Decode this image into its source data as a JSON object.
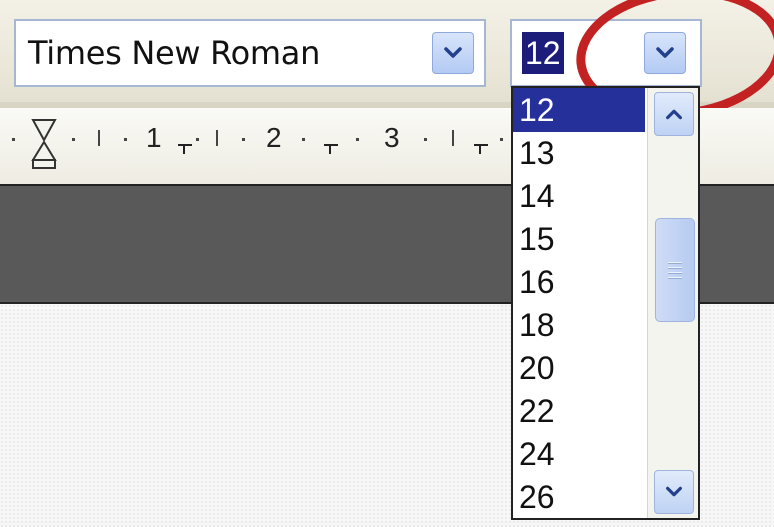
{
  "toolbar": {
    "font_name": "Times New Roman",
    "font_size": "12",
    "font_dropdown_icon": "chevron-down-icon",
    "size_dropdown_icon": "chevron-down-icon"
  },
  "ruler": {
    "numbers": [
      "1",
      "2",
      "3"
    ],
    "indent_marker_icon": "hourglass-indent-icon"
  },
  "size_list": {
    "options": [
      "12",
      "13",
      "14",
      "15",
      "16",
      "18",
      "20",
      "22",
      "24",
      "26"
    ],
    "selected": "12"
  },
  "colors": {
    "highlight": "#c32222",
    "selection": "#26309b",
    "dark_band": "#595959"
  }
}
